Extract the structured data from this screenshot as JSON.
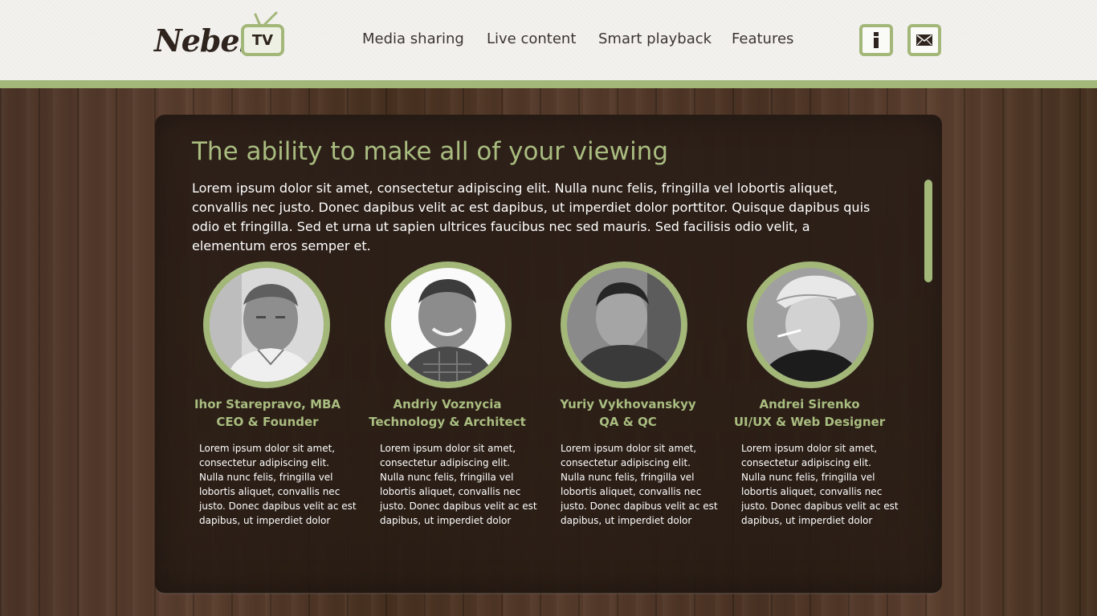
{
  "brand": {
    "logo_text": "Nebel.",
    "logo_badge": "TV"
  },
  "nav": {
    "items": [
      "Media sharing",
      "Live content",
      "Smart playback",
      "Features"
    ]
  },
  "header_icons": [
    {
      "icon": "info-icon",
      "glyph": "i"
    },
    {
      "icon": "mail-icon",
      "glyph": "✉"
    }
  ],
  "colors": {
    "accent": "#a3b779",
    "heading": "#a9bd80",
    "dark": "#2f241d"
  },
  "main": {
    "title": "The ability to make all of your viewing",
    "intro": "Lorem ipsum dolor sit amet, consectetur adipiscing elit. Nulla nunc felis, fringilla vel lobortis aliquet, convallis nec justo. Donec dapibus velit ac est dapibus, ut imperdiet dolor porttitor. Quisque dapibus quis odio et fringilla. Sed et urna ut sapien ultrices faucibus nec sed mauris. Sed facilisis odio velit, a elementum eros semper et."
  },
  "team": [
    {
      "name": "Ihor Starepravo, MBA",
      "role": "CEO & Founder",
      "bio": "Lorem ipsum dolor sit amet, consectetur adipiscing elit. Nulla nunc felis, fringilla vel lobortis aliquet, convallis nec justo. Donec dapibus velit ac est dapibus, ut imperdiet dolor porttitor. Quisque dapibus quis odio et"
    },
    {
      "name": "Andriy Voznycia",
      "role": "Technology & Architect",
      "bio": "Lorem ipsum dolor sit amet, consectetur adipiscing elit. Nulla nunc felis, fringilla vel lobortis aliquet, convallis nec justo. Donec dapibus velit ac est dapibus, ut imperdiet dolor porttitor. Quisque dapibus quis odio et"
    },
    {
      "name": "Yuriy Vykhovanskyy",
      "role": "QA & QC",
      "bio": "Lorem ipsum dolor sit amet, consectetur adipiscing elit. Nulla nunc felis, fringilla vel lobortis aliquet, convallis nec justo. Donec dapibus velit ac est dapibus, ut imperdiet dolor porttitor. Quisque dapibus quis odio et"
    },
    {
      "name": "Andrei Sirenko",
      "role": "UI/UX & Web Designer",
      "bio": "Lorem ipsum dolor sit amet, consectetur adipiscing elit. Nulla nunc felis, fringilla vel lobortis aliquet, convallis nec justo. Donec dapibus velit ac est dapibus, ut imperdiet dolor porttitor. Quisque dapibus quis odio et"
    }
  ]
}
